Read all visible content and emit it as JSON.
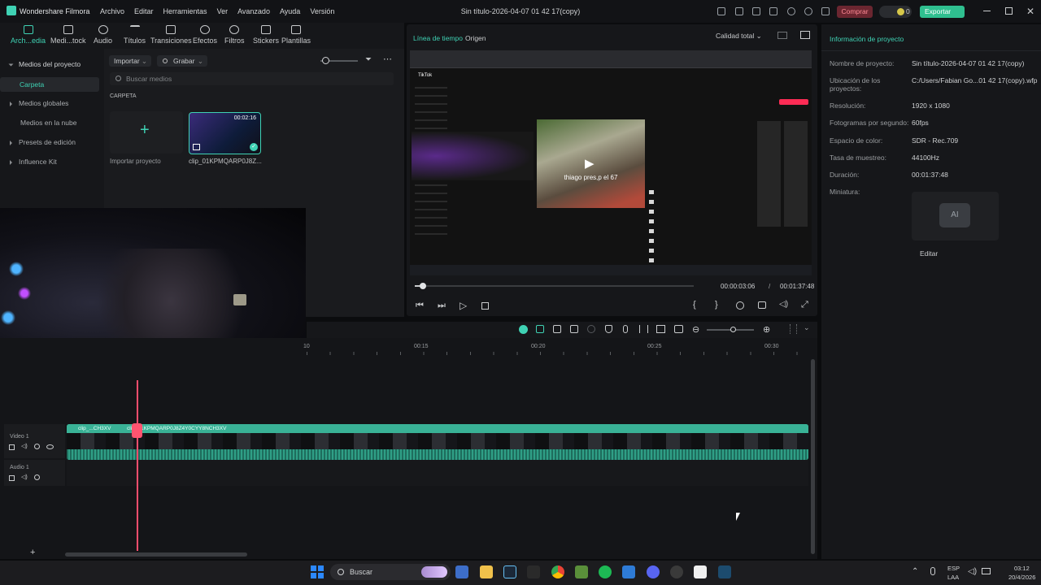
{
  "app": {
    "name": "Wondershare Filmora",
    "title": "Sin título-2026-04-07 01 42 17(copy)"
  },
  "menu": [
    "Archivo",
    "Editar",
    "Herramientas",
    "Ver",
    "Avanzado",
    "Ayuda",
    "Versión"
  ],
  "header": {
    "buy_label": "Comprar",
    "credits": "0",
    "export_label": "Exportar"
  },
  "toolbar": [
    {
      "label": "Arch...edia",
      "icon": "media-icon"
    },
    {
      "label": "Medi...tock",
      "icon": "stock-icon"
    },
    {
      "label": "Audio",
      "icon": "music-icon"
    },
    {
      "label": "Títulos",
      "icon": "text-icon"
    },
    {
      "label": "Transiciones",
      "icon": "transition-icon"
    },
    {
      "label": "Efectos",
      "icon": "effects-icon"
    },
    {
      "label": "Filtros",
      "icon": "filter-icon"
    },
    {
      "label": "Stickers",
      "icon": "sticker-icon"
    },
    {
      "label": "Plantillas",
      "icon": "template-icon"
    }
  ],
  "sidebar": {
    "items": [
      {
        "label": "Medios del proyecto",
        "expanded": true
      },
      {
        "label": "Carpeta",
        "active": true
      },
      {
        "label": "Medios globales"
      },
      {
        "label": "Medios en la nube"
      },
      {
        "label": "Presets de edición"
      },
      {
        "label": "Influence Kit"
      }
    ]
  },
  "media": {
    "import_label": "Importar",
    "record_label": "Grabar",
    "search_placeholder": "Buscar medios",
    "folder_label": "CARPETA",
    "import_project_label": "Importar proyecto",
    "clip_name": "clip_01KPMQARP0J8Z...",
    "clip_duration": "00:02:16"
  },
  "preview": {
    "tab_timeline": "Línea de tiempo",
    "tab_source": "Origen",
    "quality": "Calidad total",
    "current_time": "00:00:03:06",
    "separator": "/",
    "total_time": "00:01:37:48",
    "progress": 0.03,
    "overlay_caption": "thiago pres,p el 67",
    "site_name": "TikTok"
  },
  "project_info": {
    "heading": "Información de proyecto",
    "rows": [
      {
        "label": "Nombre de proyecto:",
        "value": "Sin título-2026-04-07 01 42 17(copy)"
      },
      {
        "label": "Ubicación de los proyectos:",
        "value": "C:/Users/Fabian Go...01 42 17(copy).wfp"
      },
      {
        "label": "Resolución:",
        "value": "1920 x 1080"
      },
      {
        "label": "Fotogramas por segundo:",
        "value": "60fps"
      },
      {
        "label": "Espacio de color:",
        "value": "SDR - Rec.709"
      },
      {
        "label": "Tasa de muestreo:",
        "value": "44100Hz"
      },
      {
        "label": "Duración:",
        "value": "00:01:37:48"
      },
      {
        "label": "Miniatura:",
        "value": ""
      }
    ],
    "edit_label": "Editar"
  },
  "timeline": {
    "ruler": [
      "10",
      "00:15",
      "00:20",
      "00:25",
      "00:30"
    ],
    "video_track": "Video 1",
    "audio_track": "Audio 1",
    "clip_a": "clip_...CH3XV",
    "clip_b": "clip_01KPMQARP0J8Z4Y0CYY8NCH3XV",
    "zoom_level": 0.55
  },
  "taskbar": {
    "search_label": "Buscar",
    "lang_top": "ESP",
    "lang_bottom": "LAA",
    "time": "03:12",
    "date": "20/4/2026"
  },
  "colors": {
    "accent": "#3fd2b4",
    "playhead": "#ff4d6d",
    "export": "#2fbf8f",
    "buy": "#ff5a6a"
  }
}
